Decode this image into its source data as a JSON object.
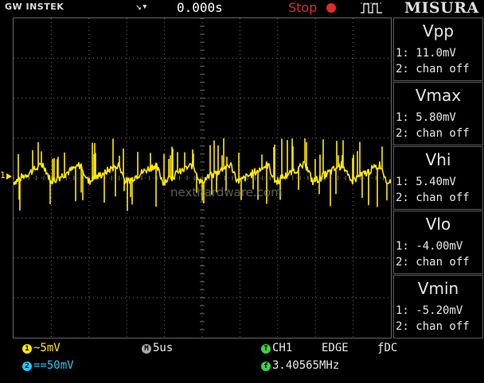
{
  "header": {
    "brand": "GW INSTEK",
    "trigger_icon": "trigger-slope-icon",
    "trigger_time": "0.000s",
    "run_state": "Stop",
    "misura": "MISURA"
  },
  "watermark": "nexthardware.com",
  "channel_marker": "1",
  "measurements": [
    {
      "title": "Vpp",
      "ch1": "1: 11.0mV",
      "ch2": "2: chan off"
    },
    {
      "title": "Vmax",
      "ch1": "1: 5.80mV",
      "ch2": "2: chan off"
    },
    {
      "title": "Vhi",
      "ch1": "1: 5.40mV",
      "ch2": "2: chan off"
    },
    {
      "title": "Vlo",
      "ch1": "1: -4.00mV",
      "ch2": "2: chan off"
    },
    {
      "title": "Vmin",
      "ch1": "1: -5.20mV",
      "ch2": "2: chan off"
    }
  ],
  "footer": {
    "ch1_scale": "~5mV",
    "ch2_scale": "==50mV",
    "timebase": "5us",
    "trig_source": "CH1",
    "trig_type": "EDGE",
    "trig_coupling": "DC",
    "frequency": "3.40565MHz",
    "ch1_badge": "1",
    "ch2_badge": "2",
    "timebase_badge": "M",
    "trig_badge": "T",
    "freq_badge": "f"
  },
  "colors": {
    "trace": "#ffea00",
    "grid": "#6a6a6a",
    "stop": "#e12b2b",
    "ch2": "#27c6f2"
  }
}
